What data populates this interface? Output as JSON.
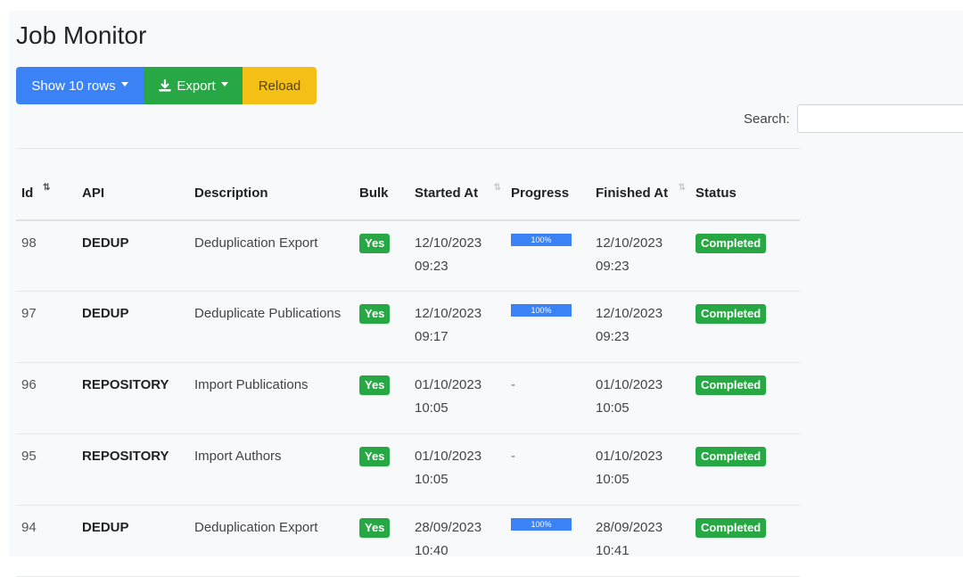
{
  "page": {
    "title": "Job Monitor"
  },
  "toolbar": {
    "rows_label": "Show 10 rows",
    "export_label": "Export",
    "reload_label": "Reload"
  },
  "search": {
    "label": "Search:",
    "value": "",
    "placeholder": ""
  },
  "table": {
    "columns": [
      {
        "label": "Id",
        "sort": "desc"
      },
      {
        "label": "API"
      },
      {
        "label": "Description"
      },
      {
        "label": "Bulk"
      },
      {
        "label": "Started At",
        "sort": "none"
      },
      {
        "label": "Progress"
      },
      {
        "label": "Finished At",
        "sort": "none"
      },
      {
        "label": "Status"
      }
    ],
    "rows": [
      {
        "id": "98",
        "api": "DEDUP",
        "description": "Deduplication Export",
        "bulk": "Yes",
        "started": "12/10/2023 09:23",
        "progress_label": "100%",
        "progress": 1.0,
        "finished": "12/10/2023 09:23",
        "status": "Completed"
      },
      {
        "id": "97",
        "api": "DEDUP",
        "description": "Deduplicate Publications",
        "bulk": "Yes",
        "started": "12/10/2023 09:17",
        "progress_label": "100%",
        "progress": 1.0,
        "finished": "12/10/2023 09:23",
        "status": "Completed"
      },
      {
        "id": "96",
        "api": "REPOSITORY",
        "description": "Import Publications",
        "bulk": "Yes",
        "started": "01/10/2023 10:05",
        "progress_label": "-",
        "progress": null,
        "finished": "01/10/2023 10:05",
        "status": "Completed"
      },
      {
        "id": "95",
        "api": "REPOSITORY",
        "description": "Import Authors",
        "bulk": "Yes",
        "started": "01/10/2023 10:05",
        "progress_label": "-",
        "progress": null,
        "finished": "01/10/2023 10:05",
        "status": "Completed"
      },
      {
        "id": "94",
        "api": "DEDUP",
        "description": "Deduplication Export",
        "bulk": "Yes",
        "started": "28/09/2023 10:40",
        "progress_label": "100%",
        "progress": 1.0,
        "finished": "28/09/2023 10:41",
        "status": "Completed"
      }
    ]
  },
  "colors": {
    "primary": "#3b82f6",
    "success": "#28a745",
    "warning": "#f5c016"
  },
  "icons": {
    "export": "download-icon",
    "sort": "sort-icon"
  }
}
